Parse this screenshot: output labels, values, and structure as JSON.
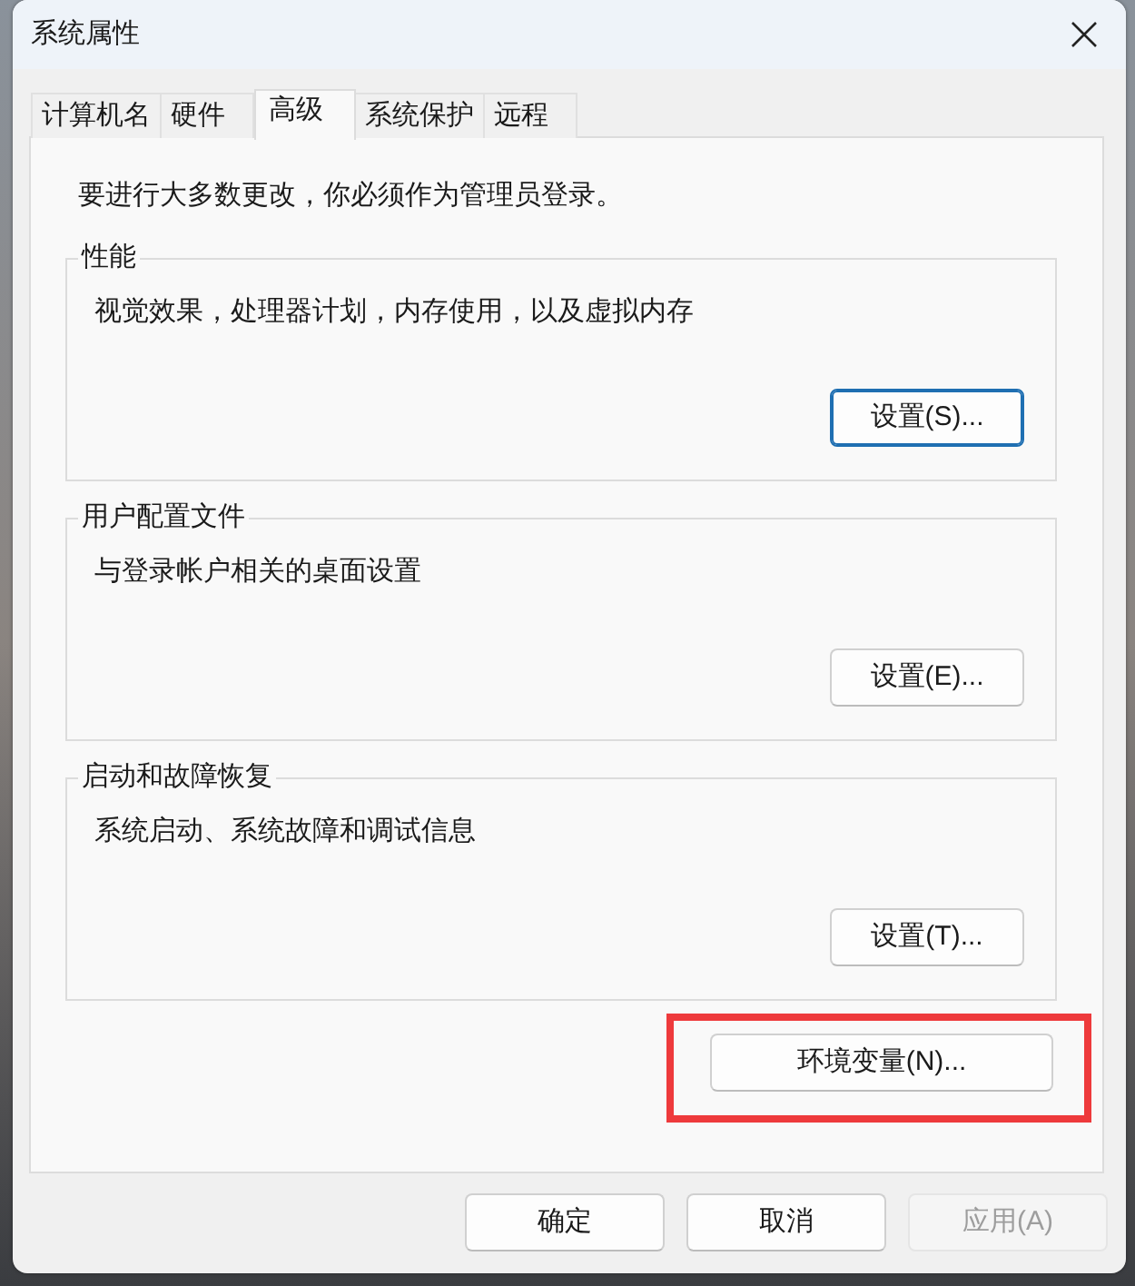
{
  "window": {
    "title": "系统属性"
  },
  "tabs": [
    {
      "label": "计算机名",
      "selected": false
    },
    {
      "label": "硬件",
      "selected": false
    },
    {
      "label": "高级",
      "selected": true
    },
    {
      "label": "系统保护",
      "selected": false
    },
    {
      "label": "远程",
      "selected": false
    }
  ],
  "notice": "要进行大多数更改，你必须作为管理员登录。",
  "groups": [
    {
      "title": "性能",
      "description": "视觉效果，处理器计划，内存使用，以及虚拟内存",
      "button": {
        "label": "设置(S)...",
        "focused": true
      }
    },
    {
      "title": "用户配置文件",
      "description": "与登录帐户相关的桌面设置",
      "button": {
        "label": "设置(E)...",
        "focused": false
      }
    },
    {
      "title": "启动和故障恢复",
      "description": "系统启动、系统故障和调试信息",
      "button": {
        "label": "设置(T)...",
        "focused": false
      }
    }
  ],
  "environment_button": {
    "label": "环境变量(N)...",
    "highlighted": true
  },
  "buttons": [
    {
      "label": "确定",
      "disabled": false
    },
    {
      "label": "取消",
      "disabled": false
    },
    {
      "label": "应用(A)",
      "disabled": true
    }
  ]
}
